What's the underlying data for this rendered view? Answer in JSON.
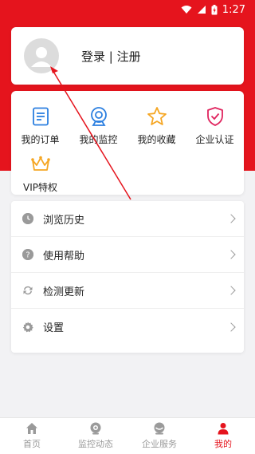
{
  "status_bar": {
    "time": "1:27"
  },
  "profile": {
    "login_label": "登录 | 注册"
  },
  "features": [
    {
      "label": "我的订单",
      "icon": "order-icon"
    },
    {
      "label": "我的监控",
      "icon": "camera-icon"
    },
    {
      "label": "我的收藏",
      "icon": "star-icon"
    },
    {
      "label": "企业认证",
      "icon": "shield-check-icon"
    },
    {
      "label": "VIP特权",
      "icon": "crown-icon"
    }
  ],
  "menu": [
    {
      "label": "浏览历史",
      "icon": "clock-icon"
    },
    {
      "label": "使用帮助",
      "icon": "help-icon"
    },
    {
      "label": "检测更新",
      "icon": "refresh-icon"
    },
    {
      "label": "设置",
      "icon": "gear-icon"
    }
  ],
  "tabs": [
    {
      "label": "首页",
      "icon": "home-icon"
    },
    {
      "label": "监控动态",
      "icon": "monitor-icon"
    },
    {
      "label": "企业服务",
      "icon": "service-icon"
    },
    {
      "label": "我的",
      "icon": "person-icon",
      "active": true
    }
  ],
  "colors": {
    "brand": "#e5141d",
    "icon_blue": "#2b7fe0",
    "icon_orange": "#f5a623",
    "icon_pink": "#e0245e",
    "muted": "#9a9a9a"
  }
}
